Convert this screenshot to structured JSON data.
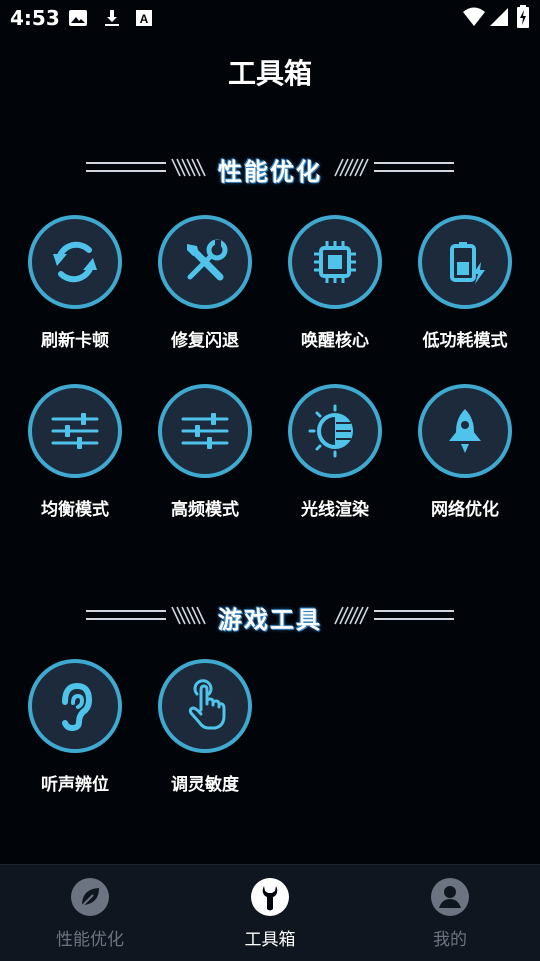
{
  "status_bar": {
    "time": "4:53",
    "icons": [
      "image-icon",
      "download-icon",
      "font-icon",
      "wifi-icon",
      "signal-icon",
      "battery-charging-icon"
    ]
  },
  "page": {
    "title": "工具箱"
  },
  "sections": [
    {
      "title": "性能优化",
      "items": [
        {
          "label": "刷新卡顿",
          "icon": "refresh-icon"
        },
        {
          "label": "修复闪退",
          "icon": "repair-tools-icon"
        },
        {
          "label": "唤醒核心",
          "icon": "cpu-chip-icon"
        },
        {
          "label": "低功耗模式",
          "icon": "battery-saver-icon"
        },
        {
          "label": "均衡模式",
          "icon": "sliders-icon"
        },
        {
          "label": "高频模式",
          "icon": "sliders-icon"
        },
        {
          "label": "光线渲染",
          "icon": "half-light-icon"
        },
        {
          "label": "网络优化",
          "icon": "rocket-icon"
        }
      ]
    },
    {
      "title": "游戏工具",
      "items": [
        {
          "label": "听声辨位",
          "icon": "ear-icon"
        },
        {
          "label": "调灵敏度",
          "icon": "touch-hand-icon"
        }
      ]
    }
  ],
  "bottom_nav": [
    {
      "label": "性能优化",
      "icon": "leaf-icon",
      "active": false
    },
    {
      "label": "工具箱",
      "icon": "wrench-icon",
      "active": true
    },
    {
      "label": "我的",
      "icon": "user-icon",
      "active": false
    }
  ],
  "colors": {
    "background": "#010409",
    "accent": "#3fa9cf",
    "icon_fill": "#1c2a3c",
    "nav_background": "#10161f",
    "nav_inactive": "#6b7480",
    "nav_active": "#ffffff"
  }
}
